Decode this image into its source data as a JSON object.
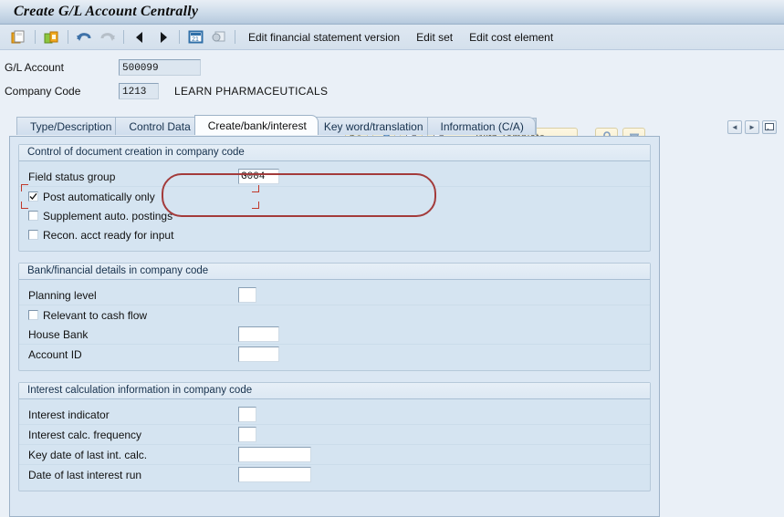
{
  "window": {
    "title": "Create G/L Account Centrally"
  },
  "toolbar": {
    "icons": [
      {
        "name": "save-icon",
        "glyph": "save"
      },
      {
        "name": "lock-open-icon",
        "glyph": "lockopen"
      },
      {
        "name": "back-arrow-icon",
        "glyph": "undo"
      },
      {
        "name": "forward-arrow-icon",
        "glyph": "redo"
      },
      {
        "name": "previous-icon",
        "glyph": "prev"
      },
      {
        "name": "next-icon",
        "glyph": "next"
      },
      {
        "name": "display-icon",
        "glyph": "display"
      },
      {
        "name": "find-icon",
        "glyph": "find"
      }
    ],
    "menus": [
      {
        "label": "Edit financial statement version"
      },
      {
        "label": "Edit set"
      },
      {
        "label": "Edit cost element"
      }
    ]
  },
  "header": {
    "gl_account_label": "G/L Account",
    "gl_account_value": "500099",
    "company_code_label": "Company Code",
    "company_code_value": "1213",
    "company_name": "LEARN PHARMACEUTICALS",
    "actions": [
      {
        "name": "display-glasses-button",
        "label": ""
      },
      {
        "name": "edit-pencil-button",
        "label": ""
      },
      {
        "name": "create-page-button",
        "label": ""
      },
      {
        "name": "with-template-button",
        "label": "With Template"
      },
      {
        "name": "lock-button",
        "label": ""
      },
      {
        "name": "delete-button",
        "label": ""
      }
    ],
    "with_template_label": "With Template"
  },
  "tabs": {
    "items": [
      {
        "label": "Type/Description",
        "active": false
      },
      {
        "label": "Control Data",
        "active": false
      },
      {
        "label": "Create/bank/interest",
        "active": true
      },
      {
        "label": "Key word/translation",
        "active": false
      },
      {
        "label": "Information (C/A)",
        "active": false
      }
    ],
    "nav": {
      "prev_label": "◄",
      "next_label": "►",
      "list_label": "❐"
    }
  },
  "sections": [
    {
      "title": "Control of document creation in company code",
      "fields": [
        {
          "type": "input",
          "label": "Field status group",
          "value": "G004",
          "width": "w-sm"
        }
      ],
      "checkboxes": [
        {
          "label": "Post automatically only",
          "checked": true
        },
        {
          "label": "Supplement auto. postings",
          "checked": false
        },
        {
          "label": "Recon. acct ready for input",
          "checked": false
        }
      ]
    },
    {
      "title": "Bank/financial details in company code",
      "rows": [
        {
          "type": "input",
          "label": "Planning level",
          "value": "",
          "width": "w-tiny"
        },
        {
          "type": "checkbox",
          "label": "Relevant to cash flow",
          "checked": false
        },
        {
          "type": "input",
          "label": "House Bank",
          "value": "",
          "width": "w-sm"
        },
        {
          "type": "input",
          "label": "Account ID",
          "value": "",
          "width": "w-sm"
        }
      ]
    },
    {
      "title": "Interest calculation information in company code",
      "rows": [
        {
          "type": "input",
          "label": "Interest indicator",
          "value": "",
          "width": "w-tiny"
        },
        {
          "type": "input",
          "label": "Interest calc. frequency",
          "value": "",
          "width": "w-tiny"
        },
        {
          "type": "input",
          "label": "Key date of last int. calc.",
          "value": "",
          "width": "w-md"
        },
        {
          "type": "input",
          "label": "Date of last interest run",
          "value": "",
          "width": "w-md"
        }
      ]
    }
  ],
  "annotation": {
    "name": "red-highlight-oval",
    "color": "#a33b3b"
  }
}
